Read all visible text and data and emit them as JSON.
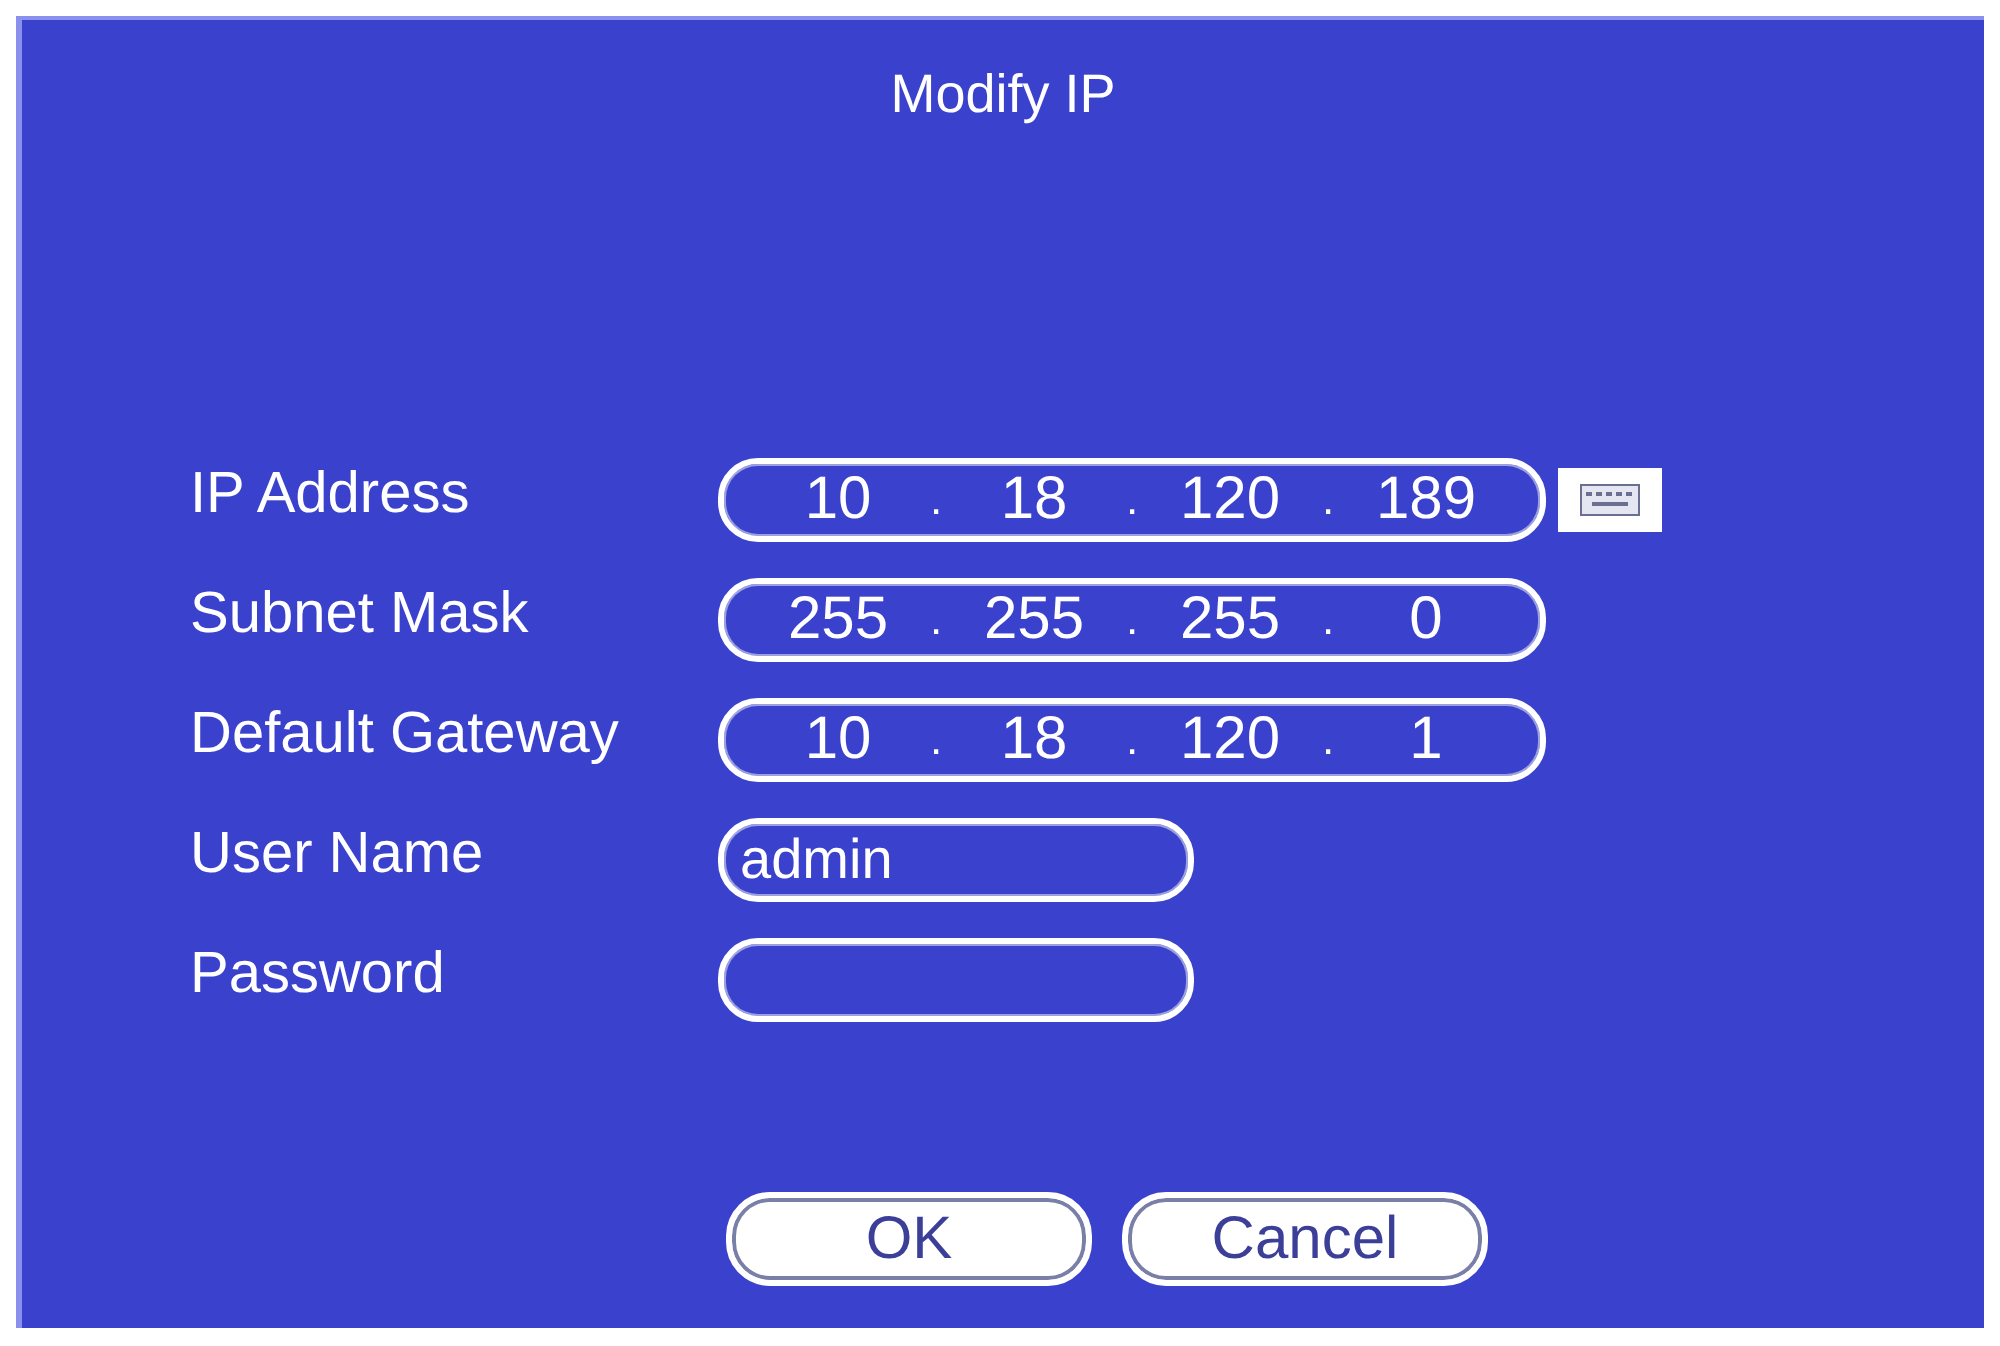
{
  "window": {
    "title": "Modify IP"
  },
  "fields": [
    {
      "label": "IP Address",
      "kind": "ip",
      "segments": [
        "10",
        ".",
        "18",
        ".",
        "120",
        ".",
        "189"
      ],
      "keyboard": true
    },
    {
      "label": "Subnet Mask",
      "kind": "ip",
      "segments": [
        "255",
        ".",
        "255",
        ".",
        "255",
        ".",
        "0"
      ]
    },
    {
      "label": "Default Gateway",
      "kind": "ip",
      "segments": [
        "10",
        ".",
        "18",
        ".",
        "120",
        ".",
        "1"
      ]
    },
    {
      "label": "User Name",
      "kind": "text",
      "value": "admin"
    },
    {
      "label": "Password",
      "kind": "text"
    }
  ],
  "buttons": [
    "OK",
    "Cancel"
  ]
}
